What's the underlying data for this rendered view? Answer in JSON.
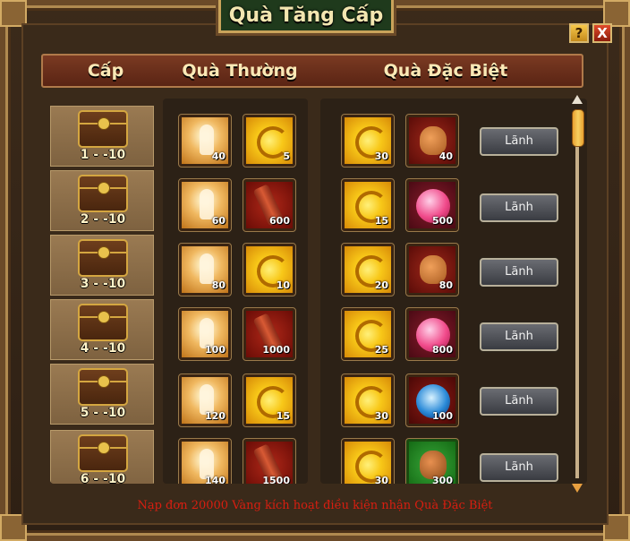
{
  "title": "Quà Tăng Cấp",
  "header": {
    "level": "Cấp",
    "normal_gift": "Quà Thường",
    "special_gift": "Quà Đặc Biệt"
  },
  "controls": {
    "help": "?",
    "close": "X"
  },
  "rows": [
    {
      "level": "1 - -10",
      "normal": [
        {
          "icon": "spirit-icon",
          "qty": "40"
        },
        {
          "icon": "gold-swirl-icon",
          "qty": "5"
        }
      ],
      "special": [
        {
          "icon": "gold-swirl-icon",
          "qty": "30"
        },
        {
          "icon": "treasure-bag-icon",
          "qty": "40"
        }
      ],
      "claim": "Lãnh"
    },
    {
      "level": "2 - -10",
      "normal": [
        {
          "icon": "spirit-icon",
          "qty": "60"
        },
        {
          "icon": "scroll-icon",
          "qty": "600"
        }
      ],
      "special": [
        {
          "icon": "gold-swirl-icon",
          "qty": "15"
        },
        {
          "icon": "pink-pearl-icon",
          "qty": "500"
        }
      ],
      "claim": "Lãnh"
    },
    {
      "level": "3 - -10",
      "normal": [
        {
          "icon": "spirit-icon",
          "qty": "80"
        },
        {
          "icon": "gold-swirl-icon",
          "qty": "10"
        }
      ],
      "special": [
        {
          "icon": "gold-swirl-icon",
          "qty": "20"
        },
        {
          "icon": "treasure-bag-icon",
          "qty": "80"
        }
      ],
      "claim": "Lãnh"
    },
    {
      "level": "4 - -10",
      "normal": [
        {
          "icon": "spirit-icon",
          "qty": "100"
        },
        {
          "icon": "scroll-icon",
          "qty": "1000"
        }
      ],
      "special": [
        {
          "icon": "gold-swirl-icon",
          "qty": "25"
        },
        {
          "icon": "pink-pearl-icon",
          "qty": "800"
        }
      ],
      "claim": "Lãnh"
    },
    {
      "level": "5 - -10",
      "normal": [
        {
          "icon": "spirit-icon",
          "qty": "120"
        },
        {
          "icon": "gold-swirl-icon",
          "qty": "15"
        }
      ],
      "special": [
        {
          "icon": "gold-swirl-icon",
          "qty": "30"
        },
        {
          "icon": "blue-orb-icon",
          "qty": "100"
        }
      ],
      "claim": "Lãnh"
    },
    {
      "level": "6 - -10",
      "normal": [
        {
          "icon": "spirit-icon",
          "qty": "140"
        },
        {
          "icon": "scroll-icon",
          "qty": "1500"
        }
      ],
      "special": [
        {
          "icon": "gold-swirl-icon",
          "qty": "30"
        },
        {
          "icon": "green-bag-icon",
          "qty": "300"
        }
      ],
      "claim": "Lãnh"
    }
  ],
  "footer_note": "Nạp đơn 20000 Vàng kích hoạt điều kiện nhận Quà Đặc Biệt",
  "colors": {
    "title_bg": "#1f3a1c",
    "header_bar": "#7a3a22",
    "footer_text": "#d81e10",
    "claim_button": "#4a4c52"
  }
}
